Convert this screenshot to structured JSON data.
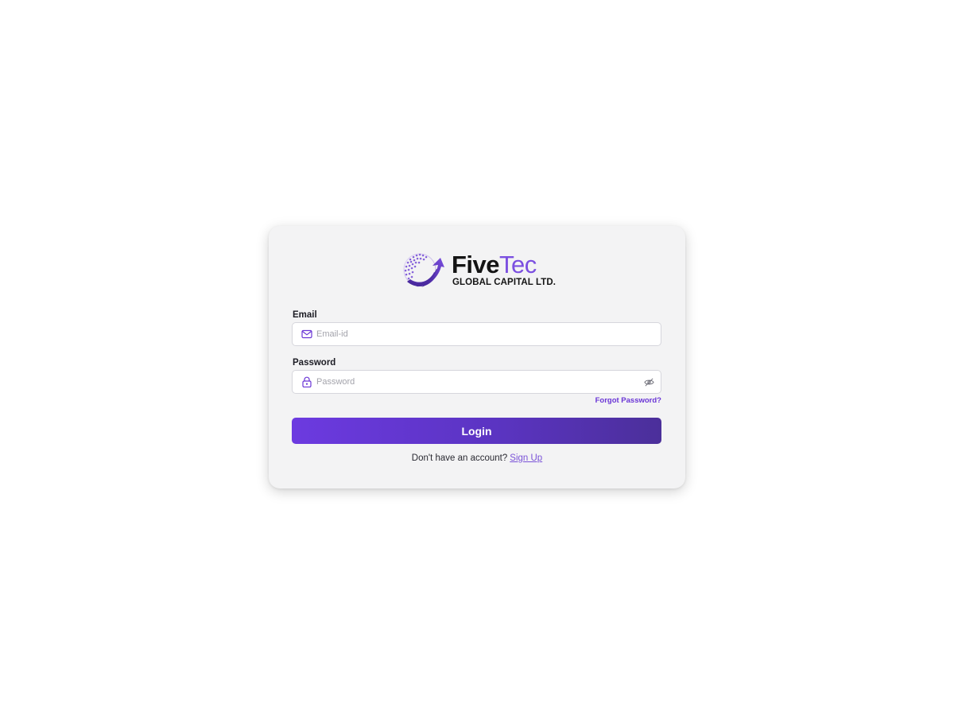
{
  "brand": {
    "name_part1": "Five",
    "name_part2": "Tec",
    "tagline": "GLOBAL CAPITAL LTD.",
    "accent_color": "#7b4fe0"
  },
  "form": {
    "email": {
      "label": "Email",
      "placeholder": "Email-id",
      "value": "",
      "icon": "mail-icon"
    },
    "password": {
      "label": "Password",
      "placeholder": "Password",
      "value": "",
      "icon": "lock-icon",
      "toggle_icon": "eye-off-icon"
    },
    "forgot_label": "Forgot Password?",
    "login_label": "Login",
    "signup_prompt": "Don't have an account?",
    "signup_label": "Sign Up"
  },
  "colors": {
    "primary": "#6c3ae0",
    "primary_dark": "#4b2f9a",
    "card_bg": "#f3f3f4",
    "link": "#7a52d8"
  }
}
